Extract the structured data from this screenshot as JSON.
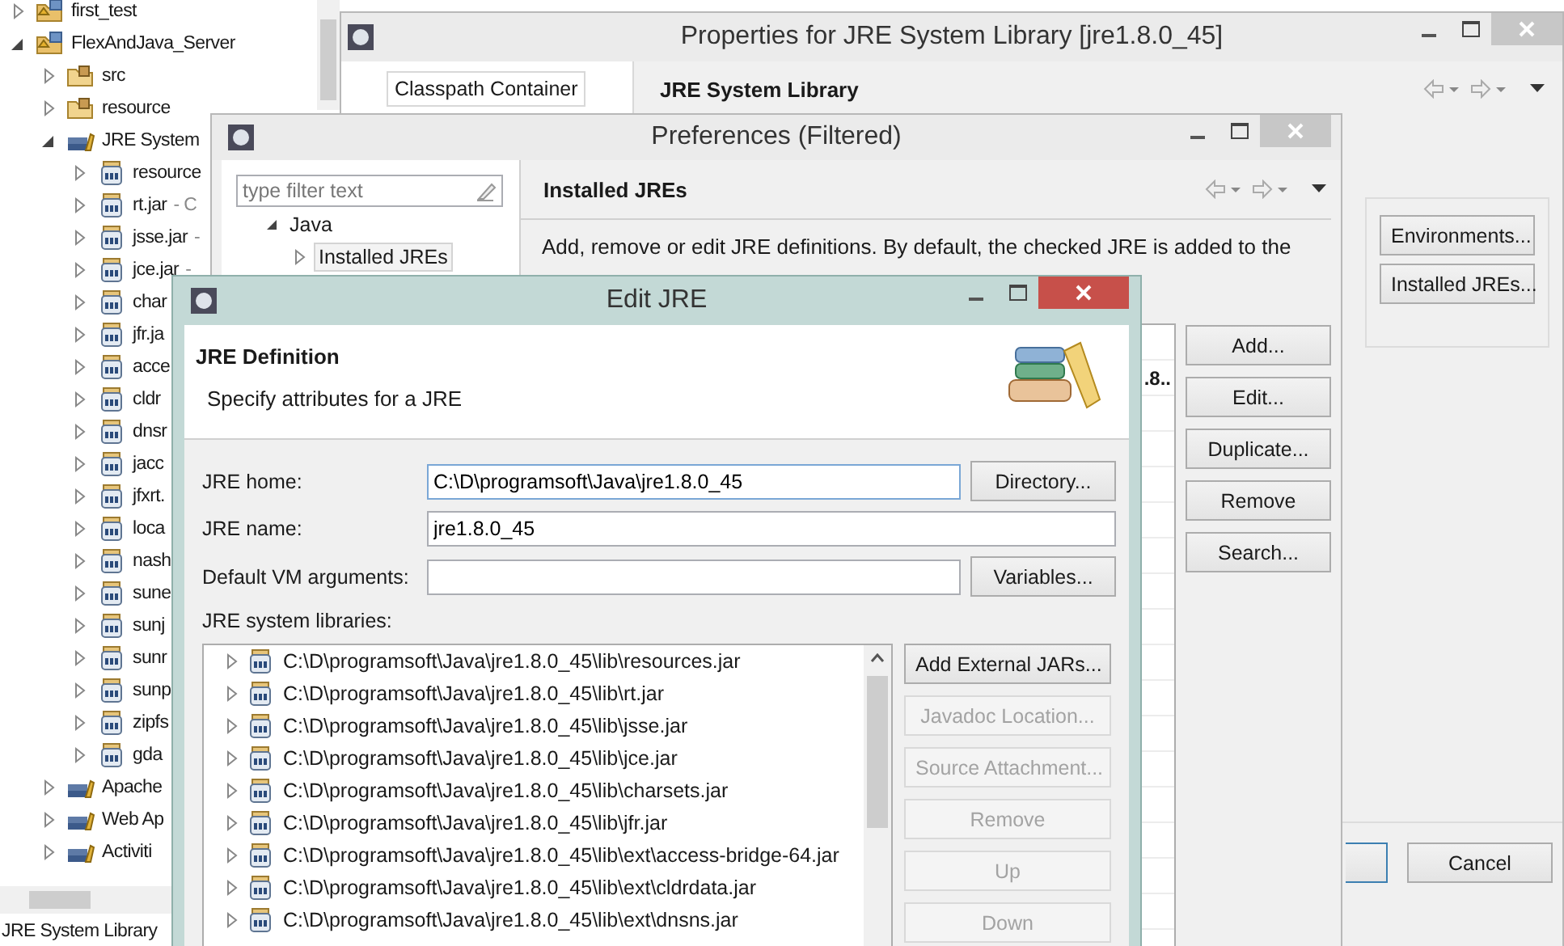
{
  "explorer": {
    "items": [
      {
        "label": "first_test",
        "kind": "project",
        "expanded": false
      },
      {
        "label": "FlexAndJava_Server",
        "kind": "project",
        "expanded": true,
        "children": [
          {
            "label": "src",
            "kind": "package-folder",
            "expanded": false
          },
          {
            "label": "resource",
            "kind": "package-folder",
            "expanded": false
          },
          {
            "label": "JRE System",
            "kind": "library",
            "expanded": true,
            "children": [
              {
                "label": "resource",
                "kind": "jar",
                "expanded": false
              },
              {
                "label": "rt.jar",
                "detail": "- C",
                "kind": "jar",
                "expanded": false
              },
              {
                "label": "jsse.jar",
                "detail": "-",
                "kind": "jar",
                "expanded": false
              },
              {
                "label": "jce.jar",
                "detail": "-",
                "kind": "jar",
                "expanded": false
              },
              {
                "label": "char",
                "kind": "jar",
                "expanded": false
              },
              {
                "label": "jfr.ja",
                "kind": "jar",
                "expanded": false
              },
              {
                "label": "acce",
                "kind": "jar",
                "expanded": false
              },
              {
                "label": "cldr",
                "kind": "jar",
                "expanded": false
              },
              {
                "label": "dnsr",
                "kind": "jar",
                "expanded": false
              },
              {
                "label": "jacc",
                "kind": "jar",
                "expanded": false
              },
              {
                "label": "jfxrt.",
                "kind": "jar",
                "expanded": false
              },
              {
                "label": "loca",
                "kind": "jar",
                "expanded": false
              },
              {
                "label": "nash",
                "kind": "jar",
                "expanded": false
              },
              {
                "label": "sune",
                "kind": "jar",
                "expanded": false
              },
              {
                "label": "sunj",
                "kind": "jar",
                "expanded": false
              },
              {
                "label": "sunr",
                "kind": "jar",
                "expanded": false
              },
              {
                "label": "sunp",
                "kind": "jar",
                "expanded": false
              },
              {
                "label": "zipfs",
                "kind": "jar",
                "expanded": false
              },
              {
                "label": "gda",
                "kind": "jar",
                "expanded": false
              }
            ]
          },
          {
            "label": "Apache",
            "kind": "library",
            "expanded": false
          },
          {
            "label": "Web Ap",
            "kind": "library",
            "expanded": false
          },
          {
            "label": "Activiti",
            "kind": "library",
            "expanded": false
          }
        ]
      }
    ],
    "status_bar": "JRE System Library"
  },
  "properties_window": {
    "title": "Properties for JRE System Library [jre1.8.0_45]",
    "sidebar_item": "Classpath Container",
    "page_title": "JRE System Library",
    "buttons": [
      "Environments...",
      "Installed JREs..."
    ],
    "footer_buttons": [
      "Cancel"
    ]
  },
  "preferences_window": {
    "title": "Preferences (Filtered)",
    "filter": {
      "placeholder": "type filter text"
    },
    "tree": [
      {
        "label": "Java",
        "expanded": true,
        "selected": false,
        "children": [
          {
            "label": "Installed JREs",
            "expanded": false,
            "selected": true
          }
        ]
      }
    ],
    "page_title": "Installed JREs",
    "description": "Add, remove or edit JRE definitions. By default, the checked JRE is added to the",
    "table_cell": ".8..",
    "buttons": [
      "Add...",
      "Edit...",
      "Duplicate...",
      "Remove",
      "Search..."
    ]
  },
  "edit_jre_dialog": {
    "title": "Edit JRE",
    "header_title": "JRE Definition",
    "header_text": "Specify attributes for a JRE",
    "jre_home": {
      "label": "JRE home:",
      "value": "C:\\D\\programsoft\\Java\\jre1.8.0_45",
      "button": "Directory..."
    },
    "jre_name": {
      "label": "JRE name:",
      "value": "jre1.8.0_45"
    },
    "vm_arguments": {
      "label": "Default VM arguments:",
      "button": "Variables..."
    },
    "libraries_label": "JRE system libraries:",
    "libraries": [
      {
        "path": "C:\\D\\programsoft\\Java\\jre1.8.0_45\\lib\\resources.jar",
        "expanded": false
      },
      {
        "path": "C:\\D\\programsoft\\Java\\jre1.8.0_45\\lib\\rt.jar",
        "expanded": false
      },
      {
        "path": "C:\\D\\programsoft\\Java\\jre1.8.0_45\\lib\\jsse.jar",
        "expanded": false
      },
      {
        "path": "C:\\D\\programsoft\\Java\\jre1.8.0_45\\lib\\jce.jar",
        "expanded": false
      },
      {
        "path": "C:\\D\\programsoft\\Java\\jre1.8.0_45\\lib\\charsets.jar",
        "expanded": false
      },
      {
        "path": "C:\\D\\programsoft\\Java\\jre1.8.0_45\\lib\\jfr.jar",
        "expanded": false
      },
      {
        "path": "C:\\D\\programsoft\\Java\\jre1.8.0_45\\lib\\ext\\access-bridge-64.jar",
        "expanded": false
      },
      {
        "path": "C:\\D\\programsoft\\Java\\jre1.8.0_45\\lib\\ext\\cldrdata.jar",
        "expanded": false
      },
      {
        "path": "C:\\D\\programsoft\\Java\\jre1.8.0_45\\lib\\ext\\dnsns.jar",
        "expanded": false
      }
    ],
    "library_buttons": [
      {
        "label": "Add External JARs...",
        "disabled": false
      },
      {
        "label": "Javadoc Location...",
        "disabled": true
      },
      {
        "label": "Source Attachment...",
        "disabled": true
      },
      {
        "label": "Remove",
        "disabled": true
      },
      {
        "label": "Up",
        "disabled": true
      },
      {
        "label": "Down",
        "disabled": true
      }
    ]
  }
}
